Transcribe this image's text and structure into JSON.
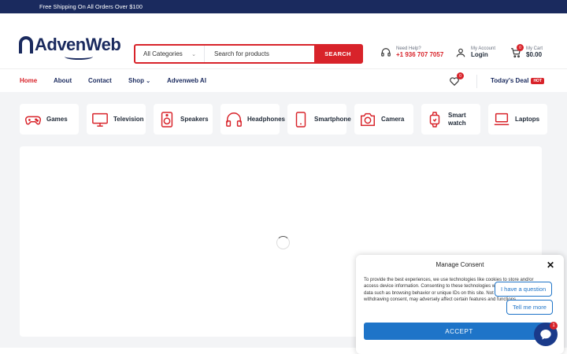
{
  "topbar": {
    "promo": "Free Shipping On All Orders Over $100"
  },
  "logo": {
    "part1": "Adven",
    "part2": "Web"
  },
  "search": {
    "category": "All Categories",
    "placeholder": "Search for products",
    "button": "SEARCH"
  },
  "help": {
    "label": "Need Help?",
    "phone": "+1 936 707 7057"
  },
  "account": {
    "label": "My Account",
    "action": "Login"
  },
  "cart": {
    "label": "My Cart",
    "total": "$0.00",
    "count": "0"
  },
  "wishlist": {
    "count": "0"
  },
  "nav": {
    "home": "Home",
    "about": "About",
    "contact": "Contact",
    "shop": "Shop",
    "ai": "Advenweb AI",
    "deal": "Today's Deal",
    "hot": "HOT"
  },
  "categories": [
    {
      "label": "Games",
      "icon": "gamepad-icon"
    },
    {
      "label": "Television",
      "icon": "television-icon"
    },
    {
      "label": "Speakers",
      "icon": "speaker-icon"
    },
    {
      "label": "Headphones",
      "icon": "headphones-icon"
    },
    {
      "label": "Smartphone",
      "icon": "smartphone-icon"
    },
    {
      "label": "Camera",
      "icon": "camera-icon"
    },
    {
      "label": "Smart watch",
      "icon": "smartwatch-icon"
    },
    {
      "label": "Laptops",
      "icon": "laptop-icon"
    }
  ],
  "consent": {
    "title": "Manage Consent",
    "text": "To provide the best experiences, we use technologies like cookies to store and/or access device information. Consenting to these technologies will allow us to process data such as browsing behavior or unique IDs on this site. Not consenting or withdrawing consent, may adversely affect certain features and functions.",
    "accept": "ACCEPT"
  },
  "chat": {
    "question": "I have a question",
    "tell": "Tell me more",
    "badge": "1"
  },
  "colors": {
    "brand_red": "#d8232a",
    "brand_navy": "#1a2a5e",
    "accept_blue": "#1e74c8"
  }
}
